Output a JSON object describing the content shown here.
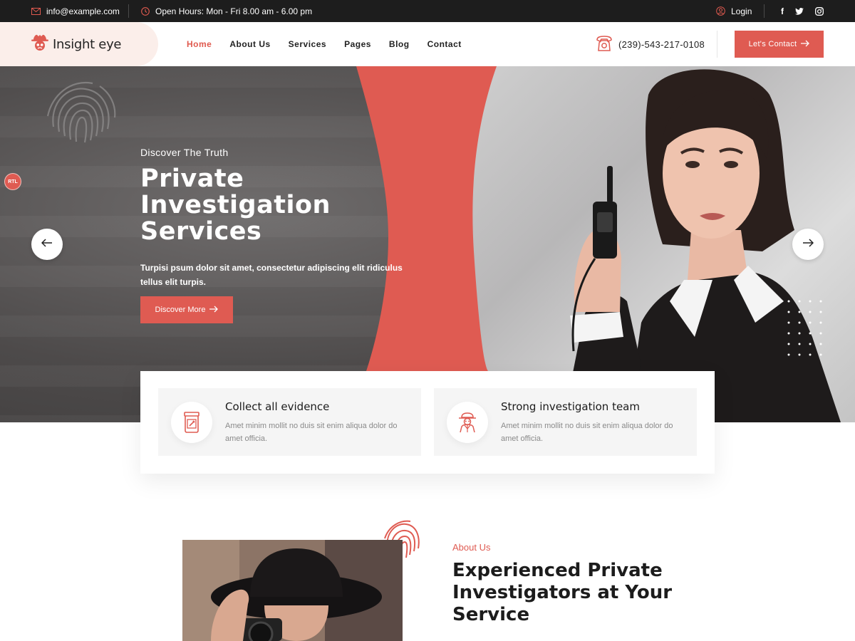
{
  "topbar": {
    "email": "info@example.com",
    "hours": "Open Hours: Mon - Fri 8.00 am - 6.00 pm",
    "login": "Login",
    "social": [
      "f",
      "twitter-icon",
      "instagram-icon"
    ]
  },
  "header": {
    "logo_text": "Insight eye",
    "nav": [
      "Home",
      "About Us",
      "Services",
      "Pages",
      "Blog",
      "Contact"
    ],
    "active_nav": "Home",
    "phone": "(239)-543-217-0108",
    "cta": "Let's Contact"
  },
  "hero": {
    "rtl_badge": "RTL",
    "kicker": "Discover The Truth",
    "title_lines": [
      "Private",
      "Investigation",
      "Services"
    ],
    "description": "Turpisi psum dolor sit amet, consectetur adipiscing elit ridiculus tellus elit turpis.",
    "button": "Discover More"
  },
  "features": [
    {
      "title": "Collect all evidence",
      "text": "Amet minim mollit no duis sit enim aliqua dolor do amet officia.",
      "icon": "evidence-jar-icon"
    },
    {
      "title": "Strong investigation team",
      "text": "Amet minim mollit no duis sit enim aliqua dolor do amet officia.",
      "icon": "detective-icon"
    }
  ],
  "about": {
    "kicker": "About Us",
    "title": "Experienced Private Investigators at Your Service"
  },
  "colors": {
    "accent": "#df5b52",
    "dark": "#1d1d1d",
    "logo_bg": "#fbeeea"
  }
}
